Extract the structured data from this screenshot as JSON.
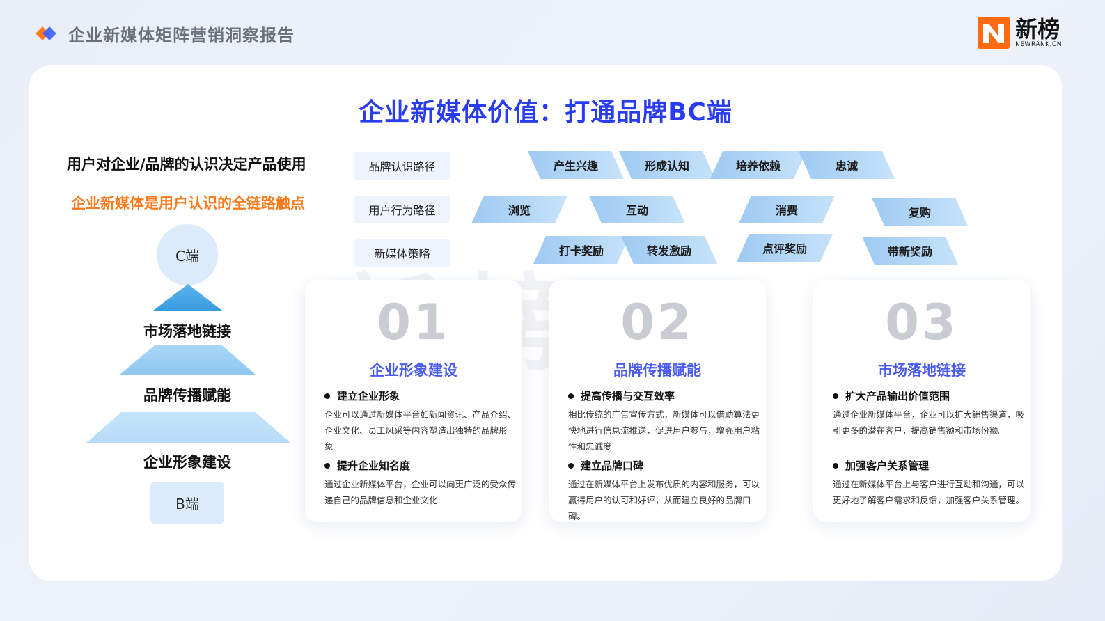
{
  "header": {
    "title": "企业新媒体矩阵营销洞察报告"
  },
  "logo": {
    "cn": "新榜",
    "en": "NEWRANK.CN"
  },
  "main_title": "企业新媒体价值：打通品牌BC端",
  "left": {
    "heading": "用户对企业/品牌的认识决定产品使用",
    "subheading": "企业新媒体是用户认识的全链路触点",
    "top_label": "C端",
    "levels": [
      "市场落地链接",
      "品牌传播赋能",
      "企业形象建设"
    ],
    "bottom_label": "B端"
  },
  "paths": {
    "rows": [
      {
        "label": "品牌认识路径",
        "items": [
          "产生兴趣",
          "形成认知",
          "培养依赖",
          "忠诚"
        ]
      },
      {
        "label": "用户行为路径",
        "items": [
          "浏览",
          "互动",
          "消费",
          "复购"
        ]
      },
      {
        "label": "新媒体策略",
        "items": [
          "打卡奖励",
          "转发激励",
          "点评奖励",
          "带新奖励"
        ]
      }
    ]
  },
  "cards": [
    {
      "num": "01",
      "title": "企业形象建设",
      "points": [
        {
          "heading": "建立企业形象",
          "text": "企业可以通过新媒体平台如新闻资讯、产品介绍、企业文化、员工风采等内容塑造出独特的品牌形象。"
        },
        {
          "heading": "提升企业知名度",
          "text": "通过企业新媒体平台，企业可以向更广泛的受众传递自己的品牌信息和企业文化"
        }
      ]
    },
    {
      "num": "02",
      "title": "品牌传播赋能",
      "points": [
        {
          "heading": "提高传播与交互效率",
          "text": "相比传统的广告宣传方式，新媒体可以借助算法更快地进行信息流推送，促进用户参与，增强用户粘性和忠诚度"
        },
        {
          "heading": "建立品牌口碑",
          "text": "通过在新媒体平台上发布优质的内容和服务，可以赢得用户的认可和好评，从而建立良好的品牌口碑。"
        }
      ]
    },
    {
      "num": "03",
      "title": "市场落地链接",
      "points": [
        {
          "heading": "扩大产品输出价值范围",
          "text": "通过企业新媒体平台，企业可以扩大销售渠道，吸引更多的潜在客户，提高销售额和市场份额。"
        },
        {
          "heading": "加强客户关系管理",
          "text": "通过在新媒体平台上与客户进行互动和沟通，可以更好地了解客户需求和反馈，加强客户关系管理。"
        }
      ]
    }
  ],
  "colors": {
    "accent_blue": "#2a3cf0",
    "accent_orange": "#ff7a1a",
    "card_title": "#4a5cf0",
    "path_fill": "#9fcaf2"
  }
}
